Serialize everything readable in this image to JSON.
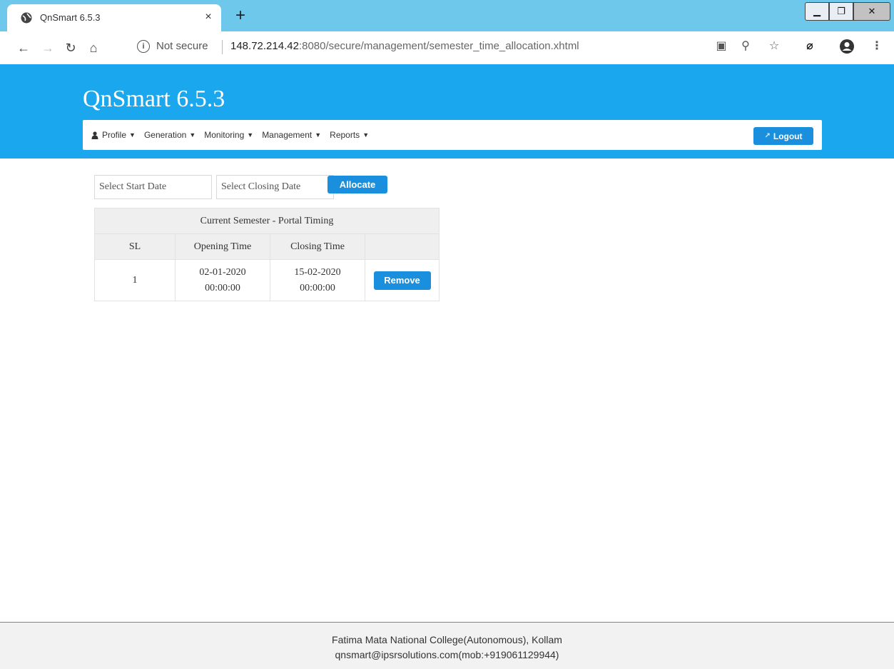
{
  "browser": {
    "tab_title": "QnSmart 6.5.3",
    "close_glyph": "×",
    "new_tab_glyph": "+",
    "not_secure_label": "Not secure",
    "url_host": "148.72.214.42",
    "url_rest": ":8080/secure/management/semester_time_allocation.xhtml",
    "nav_icons": [
      "back-icon",
      "forward-icon",
      "reload-icon",
      "home-icon"
    ],
    "toolbar_icons": [
      "translate-icon",
      "zoom-icon",
      "bookmark-star-icon",
      "extension-icon",
      "profile-icon",
      "menu-icon"
    ]
  },
  "app": {
    "title": "QnSmart 6.5.3",
    "accent_color": "#1aa7ee",
    "button_color": "#1a8fdd"
  },
  "nav": {
    "menu": [
      {
        "label": "Profile"
      },
      {
        "label": "Generation"
      },
      {
        "label": "Monitoring"
      },
      {
        "label": "Management"
      },
      {
        "label": "Reports"
      }
    ],
    "logout_label": "Logout"
  },
  "allocation": {
    "start_placeholder": "Select Start Date",
    "closing_placeholder": "Select Closing Date",
    "allocate_label": "Allocate"
  },
  "table": {
    "title": "Current Semester - Portal Timing",
    "headers": [
      "SL",
      "Opening Time",
      "Closing Time"
    ],
    "rows": [
      {
        "sl": "1",
        "opening_date": "02-01-2020",
        "opening_time": "00:00:00",
        "closing_date": "15-02-2020",
        "closing_time": "00:00:00",
        "action_label": "Remove"
      }
    ]
  },
  "footer": {
    "line1": "Fatima Mata National College(Autonomous), Kollam",
    "line2": "qnsmart@ipsrsolutions.com(mob:+919061129944)"
  }
}
